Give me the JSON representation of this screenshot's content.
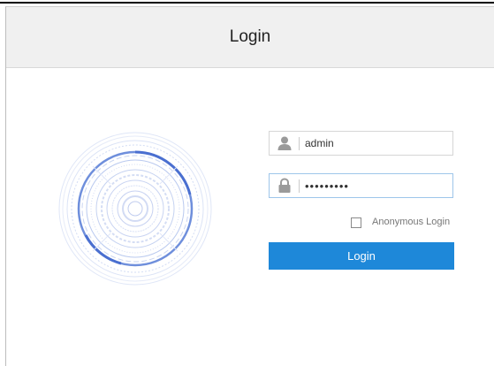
{
  "dialog": {
    "title": "Login"
  },
  "form": {
    "username": {
      "icon": "user-icon",
      "value": "admin"
    },
    "password": {
      "icon": "lock-icon",
      "value": "123456789"
    },
    "anonymous": {
      "label": "Anonymous Login",
      "checked": false
    },
    "submit_label": "Login"
  },
  "theme": {
    "accent": "#1e88d9",
    "header_bg": "#f0f0f0",
    "logo_color": "#5b7fd6"
  }
}
